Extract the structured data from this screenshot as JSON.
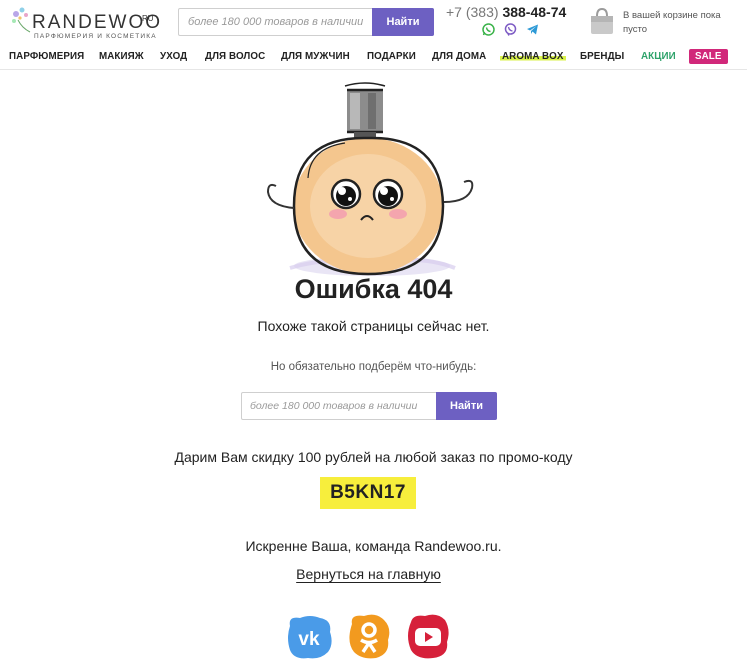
{
  "header": {
    "logo_name": "RANDEWOO",
    "logo_ru": "RU",
    "logo_tagline": "ПАРФЮМЕРИЯ И КОСМЕТИКА",
    "search_placeholder": "более 180 000 товаров в наличии",
    "search_button": "Найти",
    "phone_code": "+7 (383)",
    "phone_number": "388-48-74",
    "messengers": [
      "whatsapp-icon",
      "viber-icon",
      "telegram-icon"
    ],
    "cart_text": "В вашей корзине пока пусто"
  },
  "nav": {
    "items": [
      "ПАРФЮМЕРИЯ",
      "МАКИЯЖ",
      "УХОД",
      "ДЛЯ ВОЛОС",
      "ДЛЯ МУЖЧИН",
      "ПОДАРКИ",
      "ДЛЯ ДОМА",
      "AROMA BOX",
      "БРЕНДЫ",
      "АКЦИИ",
      "SALE"
    ]
  },
  "main": {
    "title": "Ошибка 404",
    "subtitle": "Похоже такой страницы сейчас нет.",
    "hint": "Но обязательно подберём что-нибудь:",
    "search_placeholder": "более 180 000 товаров в наличии",
    "search_button": "Найти",
    "promo_text": "Дарим Вам скидку 100 рублей на любой заказ по промо-коду",
    "promo_code": "B5KN17",
    "signature": "Искренне Ваша, команда Randewoo.ru.",
    "home_link": "Вернуться на главную"
  },
  "social": [
    "vk-icon",
    "odnoklassniki-icon",
    "youtube-icon"
  ],
  "colors": {
    "accent": "#6d60c2",
    "promo_bg": "#f7ee3c",
    "sale_badge": "#d1287a",
    "sale_text": "#2fa36b",
    "aroma_highlight": "#d8f24a",
    "vk": "#4a9be8",
    "ok": "#f29a1f",
    "youtube": "#d6203a"
  }
}
